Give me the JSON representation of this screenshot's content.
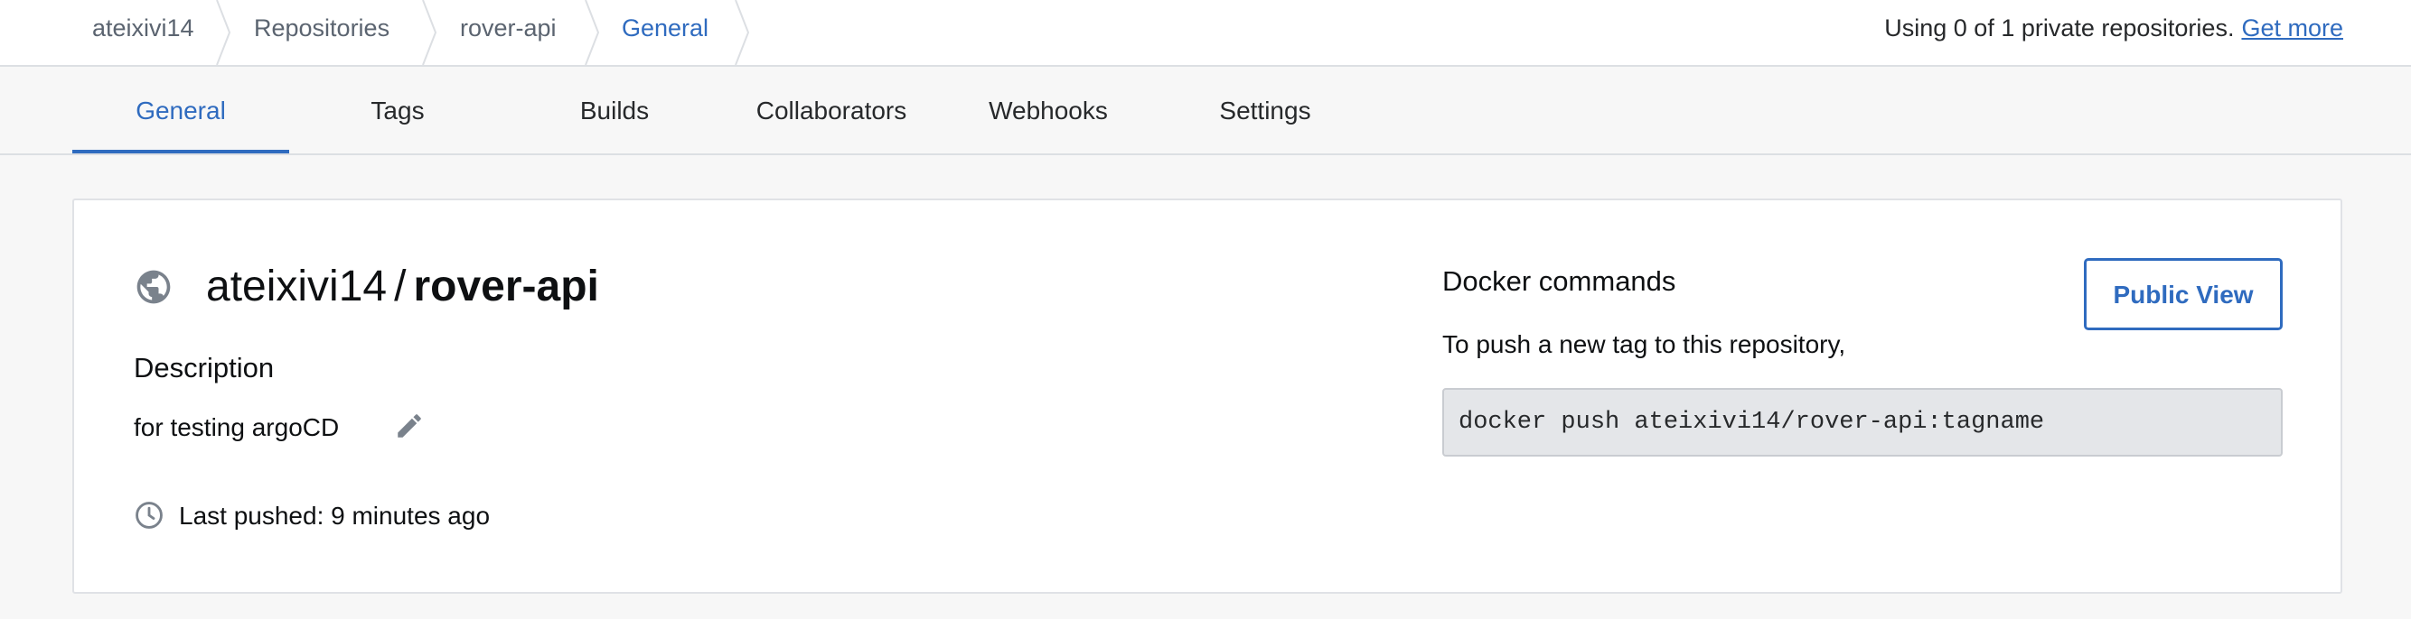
{
  "breadcrumb": {
    "items": [
      {
        "label": "ateixivi14"
      },
      {
        "label": "Repositories"
      },
      {
        "label": "rover-api"
      },
      {
        "label": "General"
      }
    ]
  },
  "plan": {
    "note": "Using 0 of 1 private repositories.",
    "link": "Get more"
  },
  "tabs": [
    {
      "label": "General",
      "active": true
    },
    {
      "label": "Tags"
    },
    {
      "label": "Builds"
    },
    {
      "label": "Collaborators"
    },
    {
      "label": "Webhooks"
    },
    {
      "label": "Settings"
    }
  ],
  "repo": {
    "namespace": "ateixivi14",
    "separator": "/",
    "name": "rover-api",
    "visibility_icon": "globe-icon",
    "description_heading": "Description",
    "description": "for testing argoCD",
    "last_pushed": "Last pushed: 9 minutes ago"
  },
  "docker": {
    "heading": "Docker commands",
    "push_instruction": "To push a new tag to this repository,",
    "command": "docker push ateixivi14/rover-api:tagname",
    "public_view_label": "Public View"
  },
  "colors": {
    "accent": "#2f6bbf",
    "page_bg": "#f7f7f7",
    "code_bg": "#e4e6e9"
  }
}
